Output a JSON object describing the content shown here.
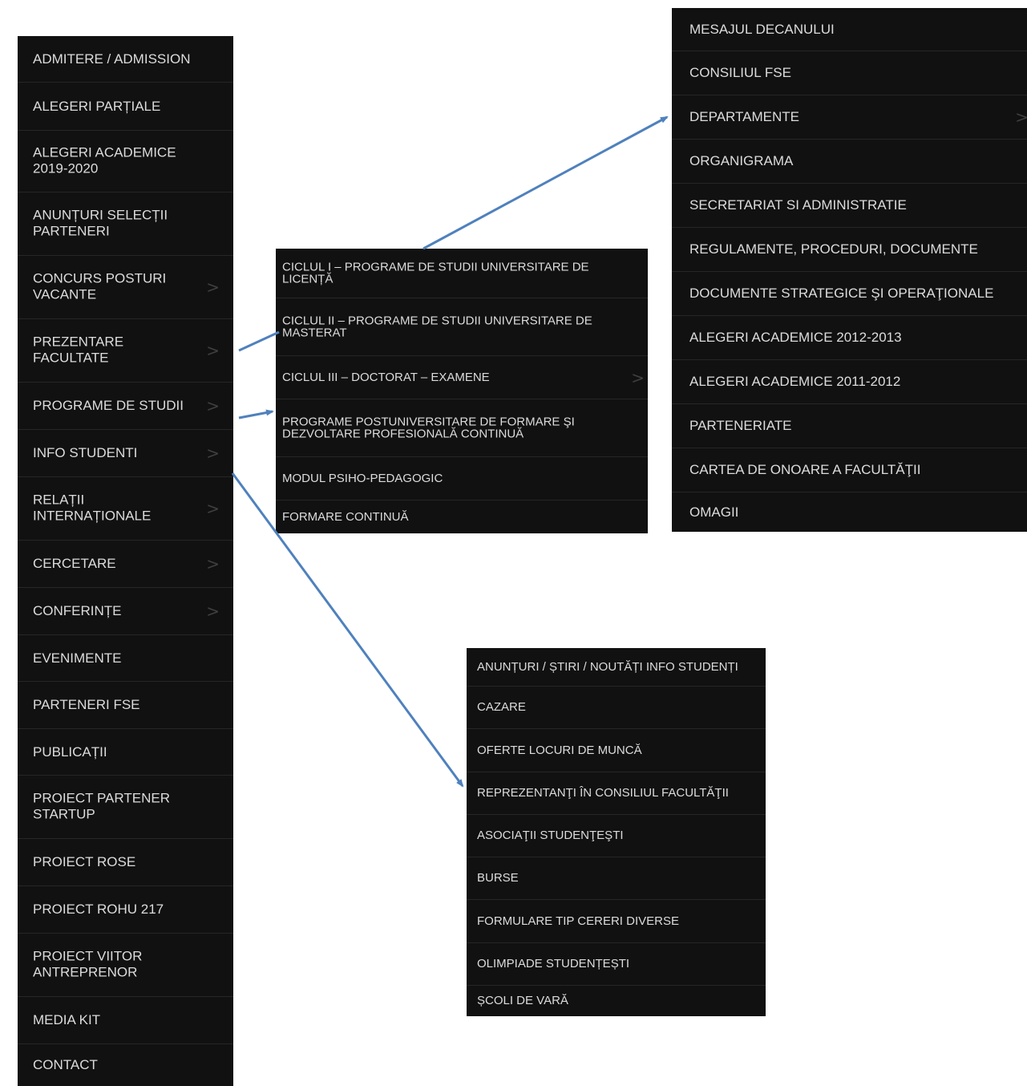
{
  "main_menu": {
    "items": [
      {
        "label": "ADMITERE / ADMISSION",
        "has_submenu": false
      },
      {
        "label": "ALEGERI PARȚIALE",
        "has_submenu": false
      },
      {
        "label": "ALEGERI ACADEMICE\n2019-2020",
        "has_submenu": false
      },
      {
        "label": "ANUNȚURI SELECȚII\nPARTENERI",
        "has_submenu": false
      },
      {
        "label": "CONCURS POSTURI\nVACANTE",
        "has_submenu": true
      },
      {
        "label": "PREZENTARE\nFACULTATE",
        "has_submenu": true
      },
      {
        "label": "PROGRAME DE STUDII",
        "has_submenu": true
      },
      {
        "label": "INFO STUDENTI",
        "has_submenu": true
      },
      {
        "label": "RELAȚII\nINTERNAȚIONALE",
        "has_submenu": true
      },
      {
        "label": "CERCETARE",
        "has_submenu": true
      },
      {
        "label": "CONFERINȚE",
        "has_submenu": true
      },
      {
        "label": "EVENIMENTE",
        "has_submenu": false
      },
      {
        "label": "PARTENERI FSE",
        "has_submenu": false
      },
      {
        "label": "PUBLICAȚII",
        "has_submenu": false
      },
      {
        "label": "PROIECT PARTENER\nSTARTUP",
        "has_submenu": false
      },
      {
        "label": "PROIECT ROSE",
        "has_submenu": false
      },
      {
        "label": "PROIECT ROHU 217",
        "has_submenu": false
      },
      {
        "label": "PROIECT VIITOR\nANTREPRENOR",
        "has_submenu": false
      },
      {
        "label": "MEDIA KIT",
        "has_submenu": false
      },
      {
        "label": "CONTACT",
        "has_submenu": false
      }
    ]
  },
  "submenu_prezentare": {
    "items": [
      {
        "label": "MESAJUL DECANULUI",
        "has_submenu": false
      },
      {
        "label": "CONSILIUL FSE",
        "has_submenu": false
      },
      {
        "label": "DEPARTAMENTE",
        "has_submenu": true
      },
      {
        "label": "ORGANIGRAMA",
        "has_submenu": false
      },
      {
        "label": "SECRETARIAT SI ADMINISTRATIE",
        "has_submenu": false
      },
      {
        "label": "REGULAMENTE, PROCEDURI, DOCUMENTE",
        "has_submenu": false
      },
      {
        "label": "DOCUMENTE STRATEGICE ŞI OPERAŢIONALE",
        "has_submenu": false
      },
      {
        "label": "ALEGERI ACADEMICE 2012-2013",
        "has_submenu": false
      },
      {
        "label": "ALEGERI ACADEMICE 2011-2012",
        "has_submenu": false
      },
      {
        "label": "PARTENERIATE",
        "has_submenu": false
      },
      {
        "label": "CARTEA DE ONOARE A FACULTĂŢII",
        "has_submenu": false
      },
      {
        "label": "OMAGII",
        "has_submenu": false
      }
    ]
  },
  "submenu_programe": {
    "items": [
      {
        "label": "CICLUL I – PROGRAME DE STUDII UNIVERSITARE DE\nLICENȚĂ",
        "has_submenu": false
      },
      {
        "label": "CICLUL II – PROGRAME DE STUDII UNIVERSITARE DE\nMASTERAT",
        "has_submenu": false
      },
      {
        "label": "CICLUL III – DOCTORAT – EXAMENE",
        "has_submenu": true
      },
      {
        "label": "PROGRAME POSTUNIVERSITARE DE FORMARE ŞI\nDEZVOLTARE PROFESIONALĂ CONTINUĂ",
        "has_submenu": false
      },
      {
        "label": "MODUL PSIHO-PEDAGOGIC",
        "has_submenu": false
      },
      {
        "label": "FORMARE CONTINUĂ",
        "has_submenu": false
      }
    ]
  },
  "submenu_info": {
    "items": [
      {
        "label": "ANUNȚURI / ȘTIRI / NOUTĂȚI INFO STUDENȚI",
        "has_submenu": false
      },
      {
        "label": "CAZARE",
        "has_submenu": false
      },
      {
        "label": "OFERTE LOCURI DE MUNCĂ",
        "has_submenu": false
      },
      {
        "label": "REPREZENTANŢI ÎN CONSILIUL FACULTĂŢII",
        "has_submenu": false
      },
      {
        "label": "ASOCIAŢII STUDENŢEŞTI",
        "has_submenu": false
      },
      {
        "label": "BURSE",
        "has_submenu": false
      },
      {
        "label": "FORMULARE TIP CERERI DIVERSE",
        "has_submenu": false
      },
      {
        "label": "OLIMPIADE STUDENȚEȘTI",
        "has_submenu": false
      },
      {
        "label": "ȘCOLI DE VARĂ",
        "has_submenu": false
      }
    ]
  },
  "chevron_glyph": ">",
  "colors": {
    "menu_background": "#111111",
    "menu_text": "#dcdcdc",
    "divider": "#262626",
    "arrow": "#4f81bd"
  }
}
